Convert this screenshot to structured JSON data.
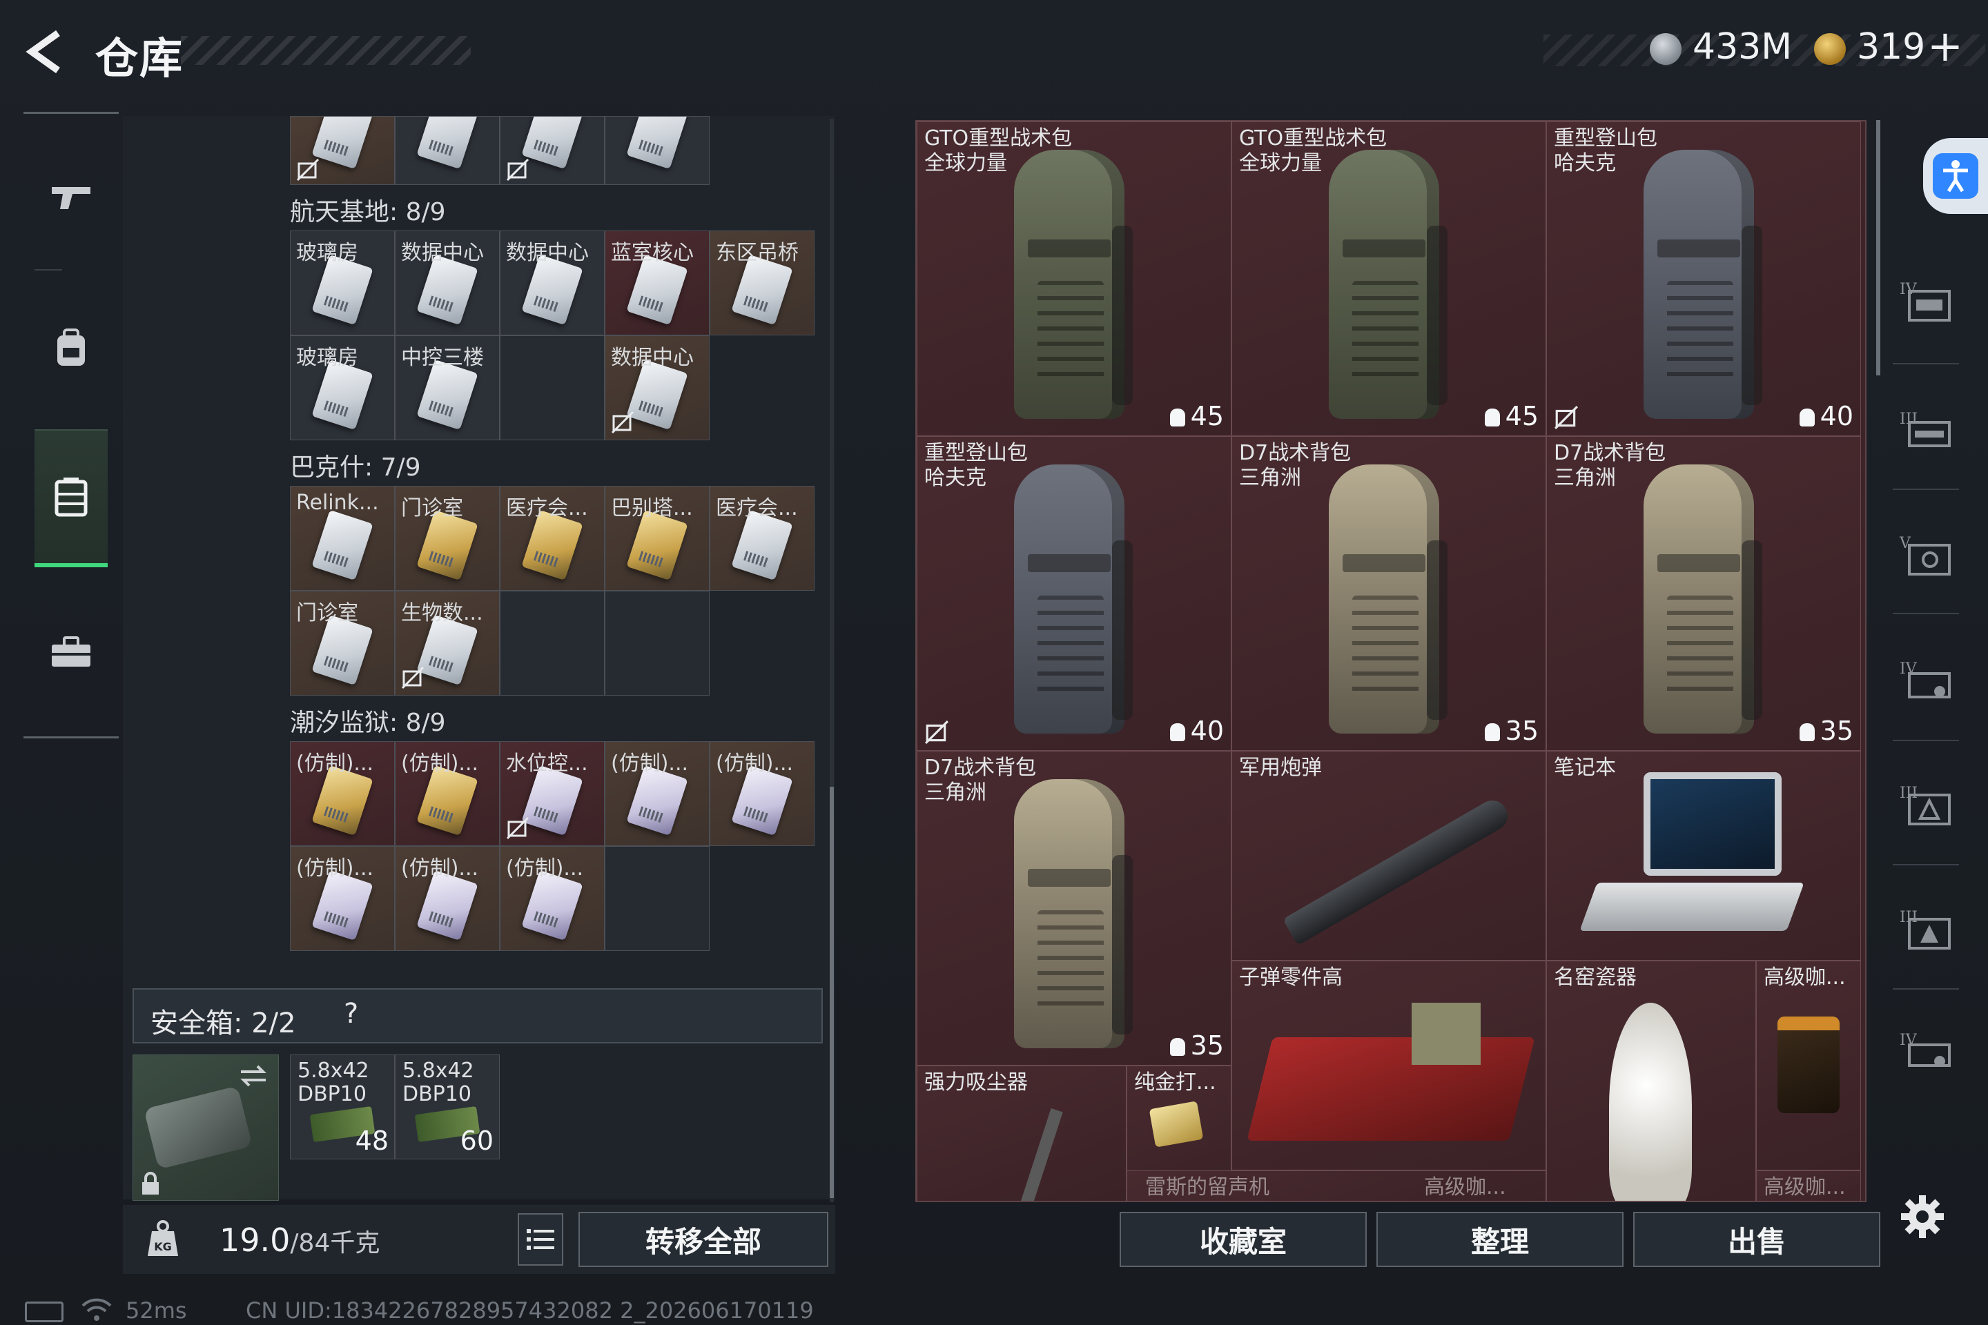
{
  "header": {
    "title": "仓库",
    "currency_silver": "433M",
    "currency_gold": "319",
    "gold_plus": "+"
  },
  "left_sections": [
    {
      "title": "航天基地: 8/9",
      "rows": [
        [
          "玻璃房",
          "数据中心",
          "数据中心",
          "蓝室核心",
          "东区吊桥"
        ],
        [
          "玻璃房",
          "中控三楼",
          "",
          "数据中心"
        ]
      ]
    },
    {
      "title": "巴克什: 7/9",
      "rows": [
        [
          "Relink...",
          "门诊室",
          "医疗会...",
          "巴别塔...",
          "医疗会..."
        ],
        [
          "门诊室",
          "生物数..."
        ]
      ]
    },
    {
      "title": "潮汐监狱: 8/9",
      "rows": [
        [
          "(仿制)...",
          "(仿制)...",
          "水位控...",
          "(仿制)...",
          "(仿制)..."
        ],
        [
          "(仿制)...",
          "(仿制)...",
          "(仿制)..."
        ]
      ]
    }
  ],
  "safe_box": {
    "title": "安全箱: 2/2",
    "help": "?",
    "slots": [
      {
        "label": "5.8x42\nDBP10",
        "count": "48"
      },
      {
        "label": "5.8x42\nDBP10",
        "count": "60"
      }
    ]
  },
  "weight": {
    "value": "19.0",
    "max": "/84千克"
  },
  "transfer_all": "转移全部",
  "storage_items": [
    {
      "name": "GTO重型战术包\n全球力量",
      "capacity": "45"
    },
    {
      "name": "GTO重型战术包\n全球力量",
      "capacity": "45"
    },
    {
      "name": "重型登山包\n哈夫克",
      "capacity": "40"
    },
    {
      "name": "重型登山包\n哈夫克",
      "capacity": "40"
    },
    {
      "name": "D7战术背包\n三角洲",
      "capacity": "35"
    },
    {
      "name": "D7战术背包\n三角洲",
      "capacity": "35"
    },
    {
      "name": "D7战术背包\n三角洲",
      "capacity": "35"
    },
    {
      "name": "军用炮弹"
    },
    {
      "name": "笔记本"
    },
    {
      "name": "子弹零件高"
    },
    {
      "name": "名窑瓷器"
    },
    {
      "name": "高级咖..."
    },
    {
      "name": "强力吸尘器"
    },
    {
      "name": "纯金打..."
    },
    {
      "name": "雷斯的留声机"
    },
    {
      "name": "高级咖..."
    },
    {
      "name": "高级咖..."
    }
  ],
  "bottom_buttons": {
    "collection": "收藏室",
    "organize": "整理",
    "sell": "出售"
  },
  "status": {
    "ping": "52ms",
    "uid": "CN UID:18342267828957432082 2_202606170119"
  },
  "colors": {
    "accent_green": "#3fd87f",
    "storage_bg": "#3d2428",
    "accessibility_blue": "#2f86ff"
  }
}
